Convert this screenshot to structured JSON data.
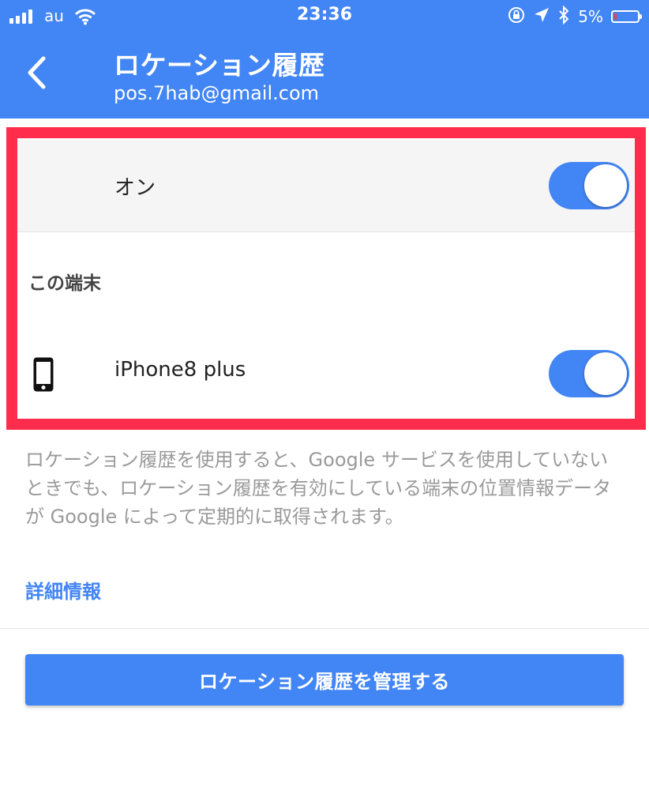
{
  "status_bar": {
    "carrier": "au",
    "time": "23:36",
    "battery_percent": "5%",
    "icons": [
      "signal-icon",
      "wifi-icon",
      "rotation-lock-icon",
      "location-arrow-icon",
      "bluetooth-icon",
      "battery-icon"
    ]
  },
  "header": {
    "title": "ロケーション履歴",
    "account": "pos.7hab@gmail.com",
    "back_icon": "chevron-left-icon"
  },
  "location_history": {
    "master_label": "オン",
    "master_enabled": true
  },
  "devices": {
    "section_title": "この端末",
    "items": [
      {
        "name": "iPhone8 plus",
        "icon": "smartphone-icon",
        "enabled": true
      }
    ]
  },
  "description": "ロケーション履歴を使用すると、Google サービスを使用していないときでも、ロケーション履歴を有効にしている端末の位置情報データが Google によって定期的に取得されます。",
  "more_info_link": "詳細情報",
  "manage_button": "ロケーション履歴を管理する",
  "colors": {
    "primary": "#4285f4",
    "highlight_border": "#ff2d4b",
    "description_text": "#9a9a9a"
  }
}
